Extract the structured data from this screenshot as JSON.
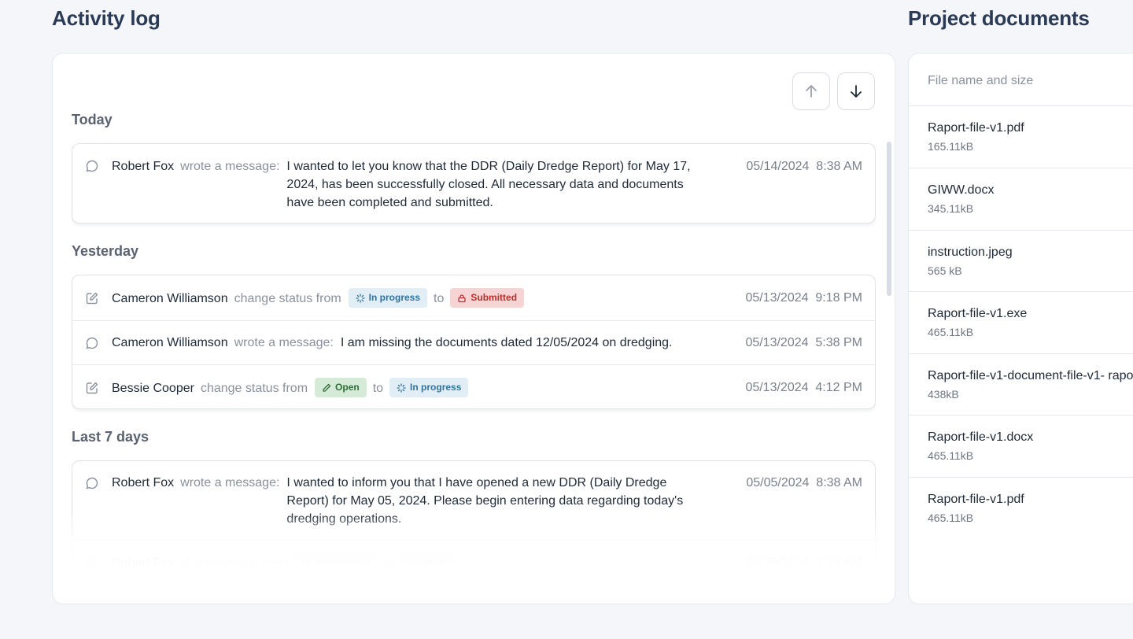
{
  "activity": {
    "title": "Activity log",
    "groups": [
      {
        "label": "Today",
        "rows": [
          {
            "author": "Robert Fox",
            "action": "wrote a message:",
            "message": "I wanted to let you know that the DDR (Daily Dredge Report) for May 17, 2024, has been successfully closed. All necessary data and documents have been completed and submitted.",
            "date": "05/14/2024",
            "time": "8:38 AM"
          }
        ]
      },
      {
        "label": "Yesterday",
        "rows": [
          {
            "author": "Cameron Williamson",
            "action": "change status from",
            "from_status": "In progress",
            "to_word": "to",
            "to_status": "Submitted",
            "date": "05/13/2024",
            "time": "9:18 PM"
          },
          {
            "author": "Cameron Williamson",
            "action": "wrote a message:",
            "message": "I am missing the documents dated 12/05/2024 on dredging.",
            "date": "05/13/2024",
            "time": "5:38 PM"
          },
          {
            "author": "Bessie Cooper",
            "action": "change status from",
            "from_status": "Open",
            "to_word": "to",
            "to_status": "In progress",
            "date": "05/13/2024",
            "time": "4:12 PM"
          }
        ]
      },
      {
        "label": "Last 7 days",
        "rows": [
          {
            "author": "Robert Fox",
            "action": "wrote a message:",
            "message": "I wanted to inform you that I have opened a new DDR (Daily Dredge Report) for May 05, 2024. Please begin entering data regarding today's dredging operations.",
            "date": "05/05/2024",
            "time": "8:38 AM"
          },
          {
            "author": "Robert Fox",
            "action": "change status from",
            "from_status": "Inaccessible",
            "to_word": "to",
            "to_status": "Open",
            "date": "05/05/2024",
            "time": "7:18 AM"
          }
        ]
      }
    ]
  },
  "documents": {
    "title": "Project documents",
    "header": "File name and size",
    "files": [
      {
        "name": "Raport-file-v1.pdf",
        "size": "165.11kB"
      },
      {
        "name": "GIWW.docx",
        "size": "345.11kB"
      },
      {
        "name": "instruction.jpeg",
        "size": "565 kB"
      },
      {
        "name": "Raport-file-v1.exe",
        "size": "465.11kB"
      },
      {
        "name": "Raport-file-v1-document-file-v1- rapo",
        "size": "438kB"
      },
      {
        "name": "Raport-file-v1.docx",
        "size": "465.11kB"
      },
      {
        "name": "Raport-file-v1.pdf",
        "size": "465.11kB"
      }
    ]
  },
  "icons": {
    "message": "chat-bubble-icon",
    "status": "edit-square-icon",
    "sort_up": "arrow-up-icon",
    "sort_down": "arrow-down-icon",
    "in_progress": "spinner-icon",
    "submitted": "lock-icon",
    "open": "pencil-icon",
    "inaccessible": "blocked-icon"
  },
  "colors": {
    "in_progress_bg": "#e1eef6",
    "submitted_bg": "#f6d4d4",
    "open_bg": "#d6ebd7",
    "inaccessible_bg": "#eef0f3"
  }
}
